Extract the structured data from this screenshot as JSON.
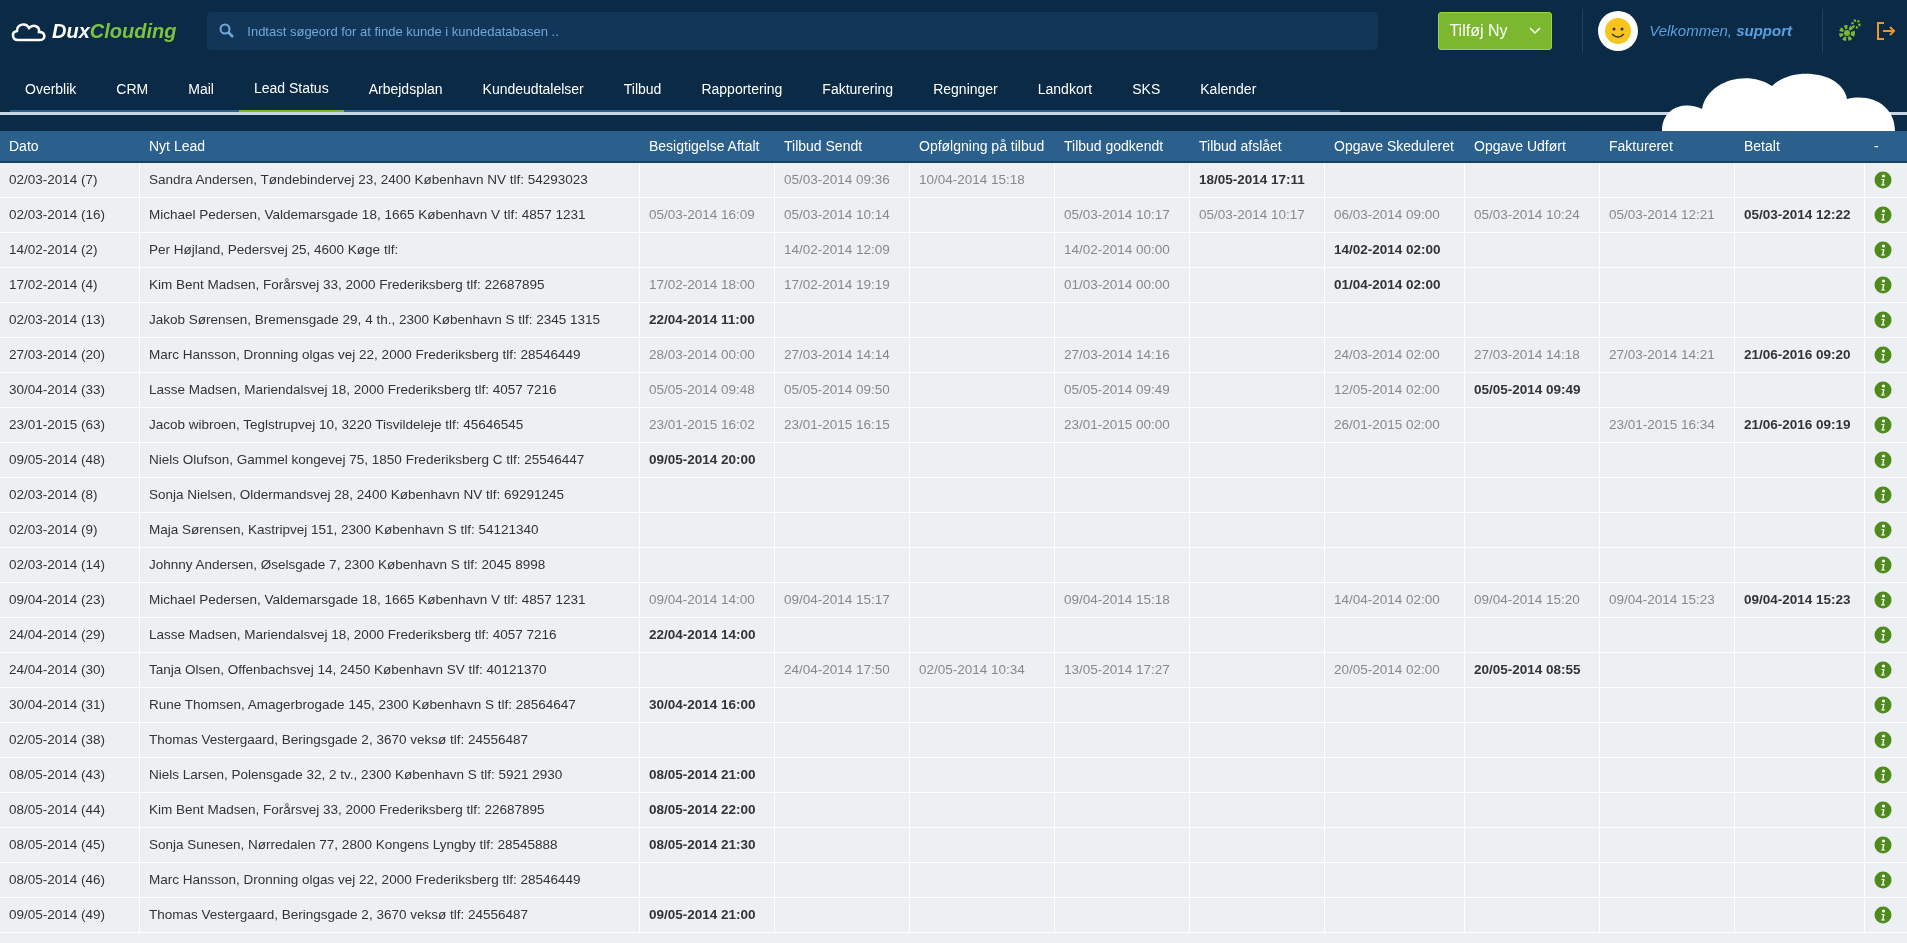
{
  "logo": {
    "part_1": "Dux",
    "part_2": "Clouding"
  },
  "search": {
    "placeholder": "Indtast søgeord for at finde kunde i kundedatabasen .."
  },
  "add_button": {
    "label": "Tilføj Ny"
  },
  "user": {
    "greeting": "Velkommen, **support**"
  },
  "nav": [
    {
      "label": "Overblik",
      "selected": false
    },
    {
      "label": "CRM",
      "selected": false
    },
    {
      "label": "Mail",
      "selected": false
    },
    {
      "label": "Lead Status",
      "selected": true
    },
    {
      "label": "Arbejdsplan",
      "selected": false
    },
    {
      "label": "Kundeudtalelser",
      "selected": false
    },
    {
      "label": "Tilbud",
      "selected": false
    },
    {
      "label": "Rapportering",
      "selected": false
    },
    {
      "label": "Fakturering",
      "selected": false
    },
    {
      "label": "Regninger",
      "selected": false
    },
    {
      "label": "Landkort",
      "selected": false
    },
    {
      "label": "SKS",
      "selected": false
    },
    {
      "label": "Kalender",
      "selected": false
    }
  ],
  "table": {
    "columns": [
      "Dato",
      "Nyt Lead",
      "Besigtigelse Aftalt",
      "Tilbud Sendt",
      "Opfølgning på tilbud",
      "Tilbud godkendt",
      "Tilbud afslået",
      "Opgave Skeduleret",
      "Opgave Udført",
      "Faktureret",
      "Betalt",
      "-"
    ],
    "rows": [
      {
        "cells": [
          "02/03-2014 (7)",
          "Sandra Andersen, Tøndebindervej 23, 2400 København NV tlf: 54293023",
          "",
          {
            "text": "05/03-2014 09:36",
            "current": false
          },
          {
            "text": "10/04-2014 15:18",
            "current": false
          },
          "",
          {
            "text": "18/05-2014 17:11",
            "current": true
          },
          "",
          "",
          "",
          ""
        ]
      },
      {
        "cells": [
          "02/03-2014 (16)",
          "Michael Pedersen, Valdemarsgade 18, 1665 København V tlf: 4857 1231",
          {
            "text": "05/03-2014 16:09",
            "current": false
          },
          {
            "text": "05/03-2014 10:14",
            "current": false
          },
          "",
          {
            "text": "05/03-2014 10:17",
            "current": false
          },
          {
            "text": "05/03-2014 10:17",
            "current": false
          },
          {
            "text": "06/03-2014 09:00",
            "current": false
          },
          {
            "text": "05/03-2014 10:24",
            "current": false
          },
          {
            "text": "05/03-2014 12:21",
            "current": false
          },
          {
            "text": "05/03-2014 12:22",
            "current": true
          }
        ]
      },
      {
        "cells": [
          "14/02-2014 (2)",
          "Per Højland, Pedersvej 25, 4600 Køge tlf:",
          "",
          {
            "text": "14/02-2014 12:09",
            "current": false
          },
          "",
          {
            "text": "14/02-2014 00:00",
            "current": false
          },
          "",
          {
            "text": "14/02-2014 02:00",
            "current": true
          },
          "",
          "",
          ""
        ]
      },
      {
        "cells": [
          "17/02-2014 (4)",
          "Kim Bent Madsen, Forårsvej 33, 2000 Frederiksberg tlf: 22687895",
          {
            "text": "17/02-2014 18:00",
            "current": false
          },
          {
            "text": "17/02-2014 19:19",
            "current": false
          },
          "",
          {
            "text": "01/03-2014 00:00",
            "current": false
          },
          "",
          {
            "text": "01/04-2014 02:00",
            "current": true
          },
          "",
          "",
          ""
        ]
      },
      {
        "cells": [
          "02/03-2014 (13)",
          "Jakob Sørensen, Bremensgade 29, 4 th., 2300 København S tlf: 2345 1315",
          {
            "text": "22/04-2014 11:00",
            "current": true
          },
          "",
          "",
          "",
          "",
          "",
          "",
          "",
          ""
        ]
      },
      {
        "cells": [
          "27/03-2014 (20)",
          "Marc Hansson, Dronning olgas vej 22, 2000 Frederiksberg tlf: 28546449",
          {
            "text": "28/03-2014 00:00",
            "current": false
          },
          {
            "text": "27/03-2014 14:14",
            "current": false
          },
          "",
          {
            "text": "27/03-2014 14:16",
            "current": false
          },
          "",
          {
            "text": "24/03-2014 02:00",
            "current": false
          },
          {
            "text": "27/03-2014 14:18",
            "current": false
          },
          {
            "text": "27/03-2014 14:21",
            "current": false
          },
          {
            "text": "21/06-2016 09:20",
            "current": true
          }
        ]
      },
      {
        "cells": [
          "30/04-2014 (33)",
          "Lasse Madsen, Mariendalsvej 18, 2000 Frederiksberg tlf: 4057 7216",
          {
            "text": "05/05-2014 09:48",
            "current": false
          },
          {
            "text": "05/05-2014 09:50",
            "current": false
          },
          "",
          {
            "text": "05/05-2014 09:49",
            "current": false
          },
          "",
          {
            "text": "12/05-2014 02:00",
            "current": false
          },
          {
            "text": "05/05-2014 09:49",
            "current": true
          },
          "",
          ""
        ]
      },
      {
        "cells": [
          "23/01-2015 (63)",
          "Jacob wibroen, Teglstrupvej 10, 3220 Tisvildeleje tlf: 45646545",
          {
            "text": "23/01-2015 16:02",
            "current": false
          },
          {
            "text": "23/01-2015 16:15",
            "current": false
          },
          "",
          {
            "text": "23/01-2015 00:00",
            "current": false
          },
          "",
          {
            "text": "26/01-2015 02:00",
            "current": false
          },
          "",
          {
            "text": "23/01-2015 16:34",
            "current": false
          },
          {
            "text": "21/06-2016 09:19",
            "current": true
          }
        ]
      },
      {
        "cells": [
          "09/05-2014 (48)",
          "Niels Olufson, Gammel kongevej 75, 1850 Frederiksberg C tlf: 25546447",
          {
            "text": "09/05-2014 20:00",
            "current": true
          },
          "",
          "",
          "",
          "",
          "",
          "",
          "",
          ""
        ]
      },
      {
        "cells": [
          "02/03-2014 (8)",
          "Sonja Nielsen, Oldermandsvej 28, 2400 København NV tlf: 69291245",
          "",
          "",
          "",
          "",
          "",
          "",
          "",
          "",
          ""
        ]
      },
      {
        "cells": [
          "02/03-2014 (9)",
          "Maja Sørensen, Kastripvej 151, 2300 København S tlf: 54121340",
          "",
          "",
          "",
          "",
          "",
          "",
          "",
          "",
          ""
        ]
      },
      {
        "cells": [
          "02/03-2014 (14)",
          "Johnny Andersen, Øselsgade 7, 2300 København S tlf: 2045 8998",
          "",
          "",
          "",
          "",
          "",
          "",
          "",
          "",
          ""
        ]
      },
      {
        "cells": [
          "09/04-2014 (23)",
          "Michael Pedersen, Valdemarsgade 18, 1665 København V tlf: 4857 1231",
          {
            "text": "09/04-2014 14:00",
            "current": false
          },
          {
            "text": "09/04-2014 15:17",
            "current": false
          },
          "",
          {
            "text": "09/04-2014 15:18",
            "current": false
          },
          "",
          {
            "text": "14/04-2014 02:00",
            "current": false
          },
          {
            "text": "09/04-2014 15:20",
            "current": false
          },
          {
            "text": "09/04-2014 15:23",
            "current": false
          },
          {
            "text": "09/04-2014 15:23",
            "current": true
          }
        ]
      },
      {
        "cells": [
          "24/04-2014 (29)",
          "Lasse Madsen, Mariendalsvej 18, 2000 Frederiksberg tlf: 4057 7216",
          {
            "text": "22/04-2014 14:00",
            "current": true
          },
          "",
          "",
          "",
          "",
          "",
          "",
          "",
          ""
        ]
      },
      {
        "cells": [
          "24/04-2014 (30)",
          "Tanja Olsen, Offenbachsvej 14, 2450 København SV tlf: 40121370",
          "",
          {
            "text": "24/04-2014 17:50",
            "current": false
          },
          {
            "text": "02/05-2014 10:34",
            "current": false
          },
          {
            "text": "13/05-2014 17:27",
            "current": false
          },
          "",
          {
            "text": "20/05-2014 02:00",
            "current": false
          },
          {
            "text": "20/05-2014 08:55",
            "current": true
          },
          "",
          ""
        ]
      },
      {
        "cells": [
          "30/04-2014 (31)",
          "Rune Thomsen, Amagerbrogade 145, 2300 København S tlf: 28564647",
          {
            "text": "30/04-2014 16:00",
            "current": true
          },
          "",
          "",
          "",
          "",
          "",
          "",
          "",
          ""
        ]
      },
      {
        "cells": [
          "02/05-2014 (38)",
          "Thomas Vestergaard, Beringsgade 2, 3670 veksø tlf: 24556487",
          "",
          "",
          "",
          "",
          "",
          "",
          "",
          "",
          ""
        ]
      },
      {
        "cells": [
          "08/05-2014 (43)",
          "Niels Larsen, Polensgade 32, 2 tv., 2300 København S tlf: 5921 2930",
          {
            "text": "08/05-2014 21:00",
            "current": true
          },
          "",
          "",
          "",
          "",
          "",
          "",
          "",
          ""
        ]
      },
      {
        "cells": [
          "08/05-2014 (44)",
          "Kim Bent Madsen, Forårsvej 33, 2000 Frederiksberg tlf: 22687895",
          {
            "text": "08/05-2014 22:00",
            "current": true
          },
          "",
          "",
          "",
          "",
          "",
          "",
          "",
          ""
        ]
      },
      {
        "cells": [
          "08/05-2014 (45)",
          "Sonja Sunesen, Nørredalen 77, 2800 Kongens Lyngby tlf: 28545888",
          {
            "text": "08/05-2014 21:30",
            "current": true
          },
          "",
          "",
          "",
          "",
          "",
          "",
          "",
          ""
        ]
      },
      {
        "cells": [
          "08/05-2014 (46)",
          "Marc Hansson, Dronning olgas vej 22, 2000 Frederiksberg tlf: 28546449",
          "",
          "",
          "",
          "",
          "",
          "",
          "",
          "",
          ""
        ]
      },
      {
        "cells": [
          "09/05-2014 (49)",
          "Thomas Vestergaard, Beringsgade 2, 3670 veksø tlf: 24556487",
          {
            "text": "09/05-2014 21:00",
            "current": true
          },
          "",
          "",
          "",
          "",
          "",
          "",
          "",
          ""
        ]
      }
    ]
  }
}
